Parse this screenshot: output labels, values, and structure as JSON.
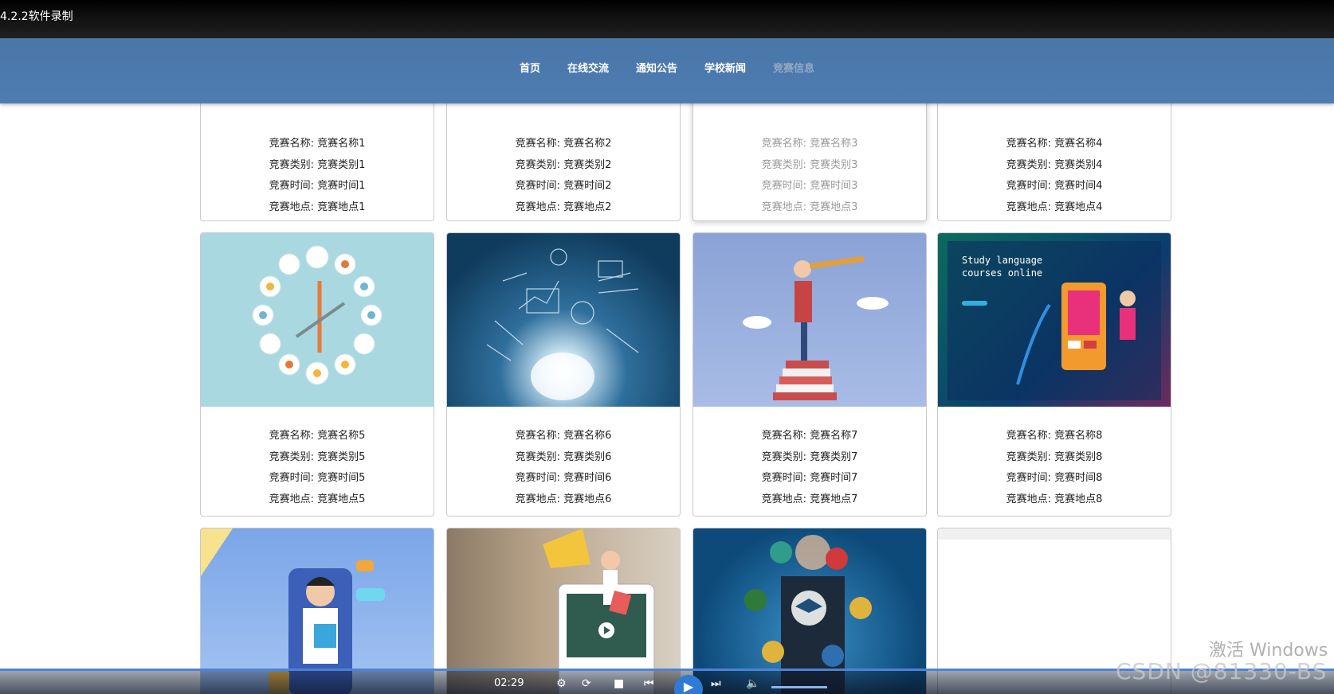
{
  "recorder": {
    "title": "4.2.2软件录制",
    "time": "02:29"
  },
  "nav": {
    "items": [
      "首页",
      "在线交流",
      "通知公告",
      "学校新闻",
      "竞赛信息"
    ]
  },
  "cards": [
    {
      "name": "竞赛名称: 竞赛名称1",
      "category": "竞赛类别: 竞赛类别1",
      "time": "竞赛时间: 竞赛时间1",
      "place": "竞赛地点: 竞赛地点1"
    },
    {
      "name": "竞赛名称: 竞赛名称2",
      "category": "竞赛类别: 竞赛类别2",
      "time": "竞赛时间: 竞赛时间2",
      "place": "竞赛地点: 竞赛地点2"
    },
    {
      "name": "竞赛名称: 竞赛名称3",
      "category": "竞赛类别: 竞赛类别3",
      "time": "竞赛时间: 竞赛时间3",
      "place": "竞赛地点: 竞赛地点3"
    },
    {
      "name": "竞赛名称: 竞赛名称4",
      "category": "竞赛类别: 竞赛类别4",
      "time": "竞赛时间: 竞赛时间4",
      "place": "竞赛地点: 竞赛地点4"
    },
    {
      "name": "竞赛名称: 竞赛名称5",
      "category": "竞赛类别: 竞赛类别5",
      "time": "竞赛时间: 竞赛时间5",
      "place": "竞赛地点: 竞赛地点5"
    },
    {
      "name": "竞赛名称: 竞赛名称6",
      "category": "竞赛类别: 竞赛类别6",
      "time": "竞赛时间: 竞赛时间6",
      "place": "竞赛地点: 竞赛地点6"
    },
    {
      "name": "竞赛名称: 竞赛名称7",
      "category": "竞赛类别: 竞赛类别7",
      "time": "竞赛时间: 竞赛时间7",
      "place": "竞赛地点: 竞赛地点7"
    },
    {
      "name": "竞赛名称: 竞赛名称8",
      "category": "竞赛类别: 竞赛类别8",
      "time": "竞赛时间: 竞赛时间8",
      "place": "竞赛地点: 竞赛地点8"
    }
  ],
  "image_texts": {
    "study_title": "Study language",
    "study_sub": "courses online"
  },
  "watermarks": {
    "activate": "激活 Windows",
    "csdn": "CSDN @81330-BS"
  },
  "colors": {
    "header": "#4a76a8",
    "active_nav": "#93a9c3",
    "border": "#c9c9c9"
  }
}
